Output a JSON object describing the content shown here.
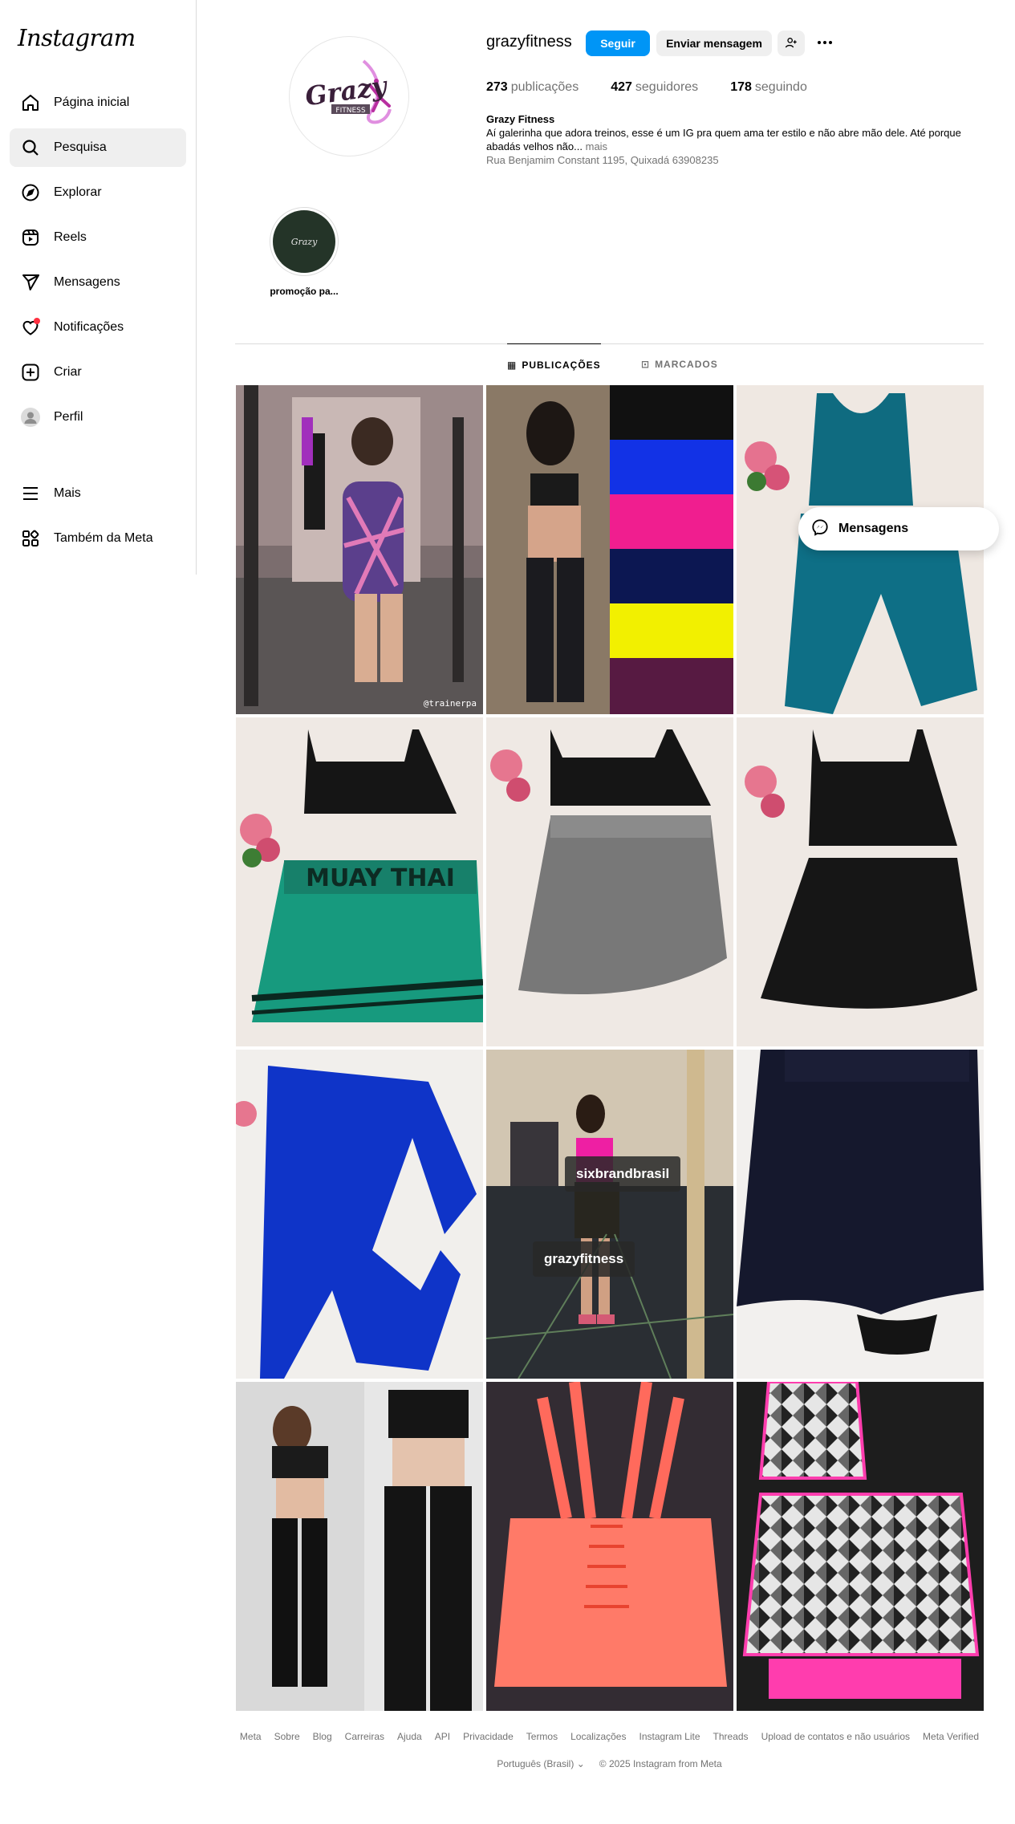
{
  "sidebar": {
    "logo": "Instagram",
    "items": [
      {
        "label": "Página inicial",
        "icon": "home-icon"
      },
      {
        "label": "Pesquisa",
        "icon": "search-icon",
        "active": true
      },
      {
        "label": "Explorar",
        "icon": "compass-icon"
      },
      {
        "label": "Reels",
        "icon": "reels-icon"
      },
      {
        "label": "Mensagens",
        "icon": "send-icon"
      },
      {
        "label": "Notificações",
        "icon": "heart-icon",
        "badge": true
      },
      {
        "label": "Criar",
        "icon": "plus-icon"
      },
      {
        "label": "Perfil",
        "icon": "profile-avatar"
      }
    ],
    "more": "Mais",
    "meta": "Também da Meta"
  },
  "profile": {
    "username": "grazyfitness",
    "follow_label": "Seguir",
    "message_label": "Enviar mensagem",
    "avatar_logo_text": "Grazy",
    "avatar_logo_sub": "FITNESS",
    "stats": {
      "posts_count": "273",
      "posts_label": "publicações",
      "followers_count": "427",
      "followers_label": "seguidores",
      "following_count": "178",
      "following_label": "seguindo"
    },
    "bio": {
      "name": "Grazy Fitness",
      "text": "Aí galerinha que adora treinos, esse é um IG pra quem ama ter estilo e não abre mão dele. Até porque abadás velhos não...",
      "more": "mais",
      "address": "Rua Benjamim Constant 1195, Quixadá 63908235"
    }
  },
  "highlight": {
    "label": "promoção pa...",
    "inner_text": "Grazy"
  },
  "tabs": [
    {
      "label": "PUBLICAÇÕES",
      "active": true
    },
    {
      "label": "MARCADOS",
      "active": false
    }
  ],
  "posts": {
    "tag_1": "sixbrandbrasil",
    "tag_2": "grazyfitness",
    "watermark": "@trainerpa",
    "skirt_text": "MUAY THAI"
  },
  "float_messages": "Mensagens",
  "footer": {
    "links": [
      "Meta",
      "Sobre",
      "Blog",
      "Carreiras",
      "Ajuda",
      "API",
      "Privacidade",
      "Termos",
      "Localizações",
      "Instagram Lite",
      "Threads",
      "Upload de contatos e não usuários",
      "Meta Verified"
    ],
    "language": "Português (Brasil)",
    "copyright": "© 2025 Instagram from Meta"
  },
  "colors": {
    "primary_blue": "#0095f6",
    "notification_red": "#ff3040",
    "border": "#dbdbdb",
    "muted_text": "#737373"
  }
}
